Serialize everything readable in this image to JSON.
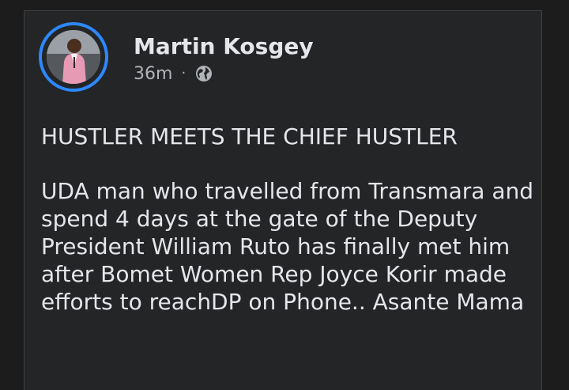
{
  "post": {
    "author": "Martin Kosgey",
    "time": "36m",
    "separator": "·",
    "privacy_icon": "globe-icon",
    "headline": "HUSTLER MEETS THE CHIEF HUSTLER",
    "body": "UDA man who travelled from Transmara and spend 4 days at the gate of the Deputy President William Ruto has finally met him after Bomet Women Rep Joyce Korir made efforts to reachDP on Phone.. Asante Mama"
  },
  "colors": {
    "background": "#1c1c1d",
    "card": "#242526",
    "text": "#e4e6eb",
    "muted": "#b0b3b8",
    "story_ring": "#2d88ff"
  }
}
